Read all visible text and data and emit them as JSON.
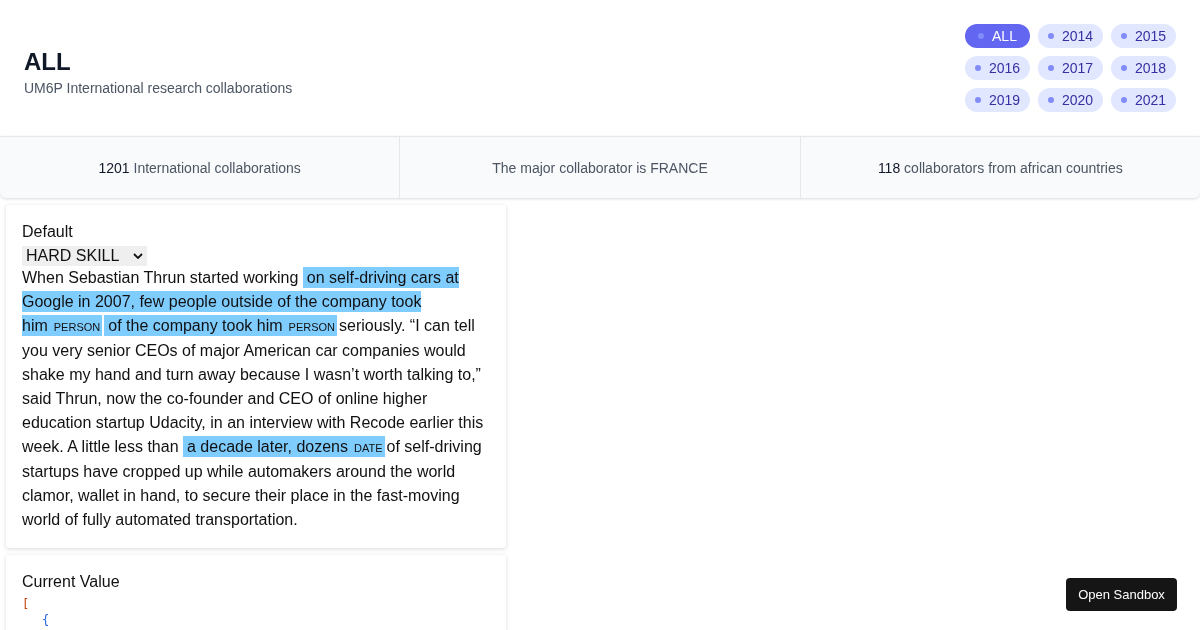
{
  "header": {
    "title": "ALL",
    "subtitle": "UM6P International research collaborations"
  },
  "year_filters": [
    {
      "label": "ALL",
      "selected": true
    },
    {
      "label": "2014",
      "selected": false
    },
    {
      "label": "2015",
      "selected": false
    },
    {
      "label": "2016",
      "selected": false
    },
    {
      "label": "2017",
      "selected": false
    },
    {
      "label": "2018",
      "selected": false
    },
    {
      "label": "2019",
      "selected": false
    },
    {
      "label": "2020",
      "selected": false
    },
    {
      "label": "2021",
      "selected": false
    }
  ],
  "stats": [
    "**1201** International collaborations",
    "The major collaborator is FRANCE",
    "**118** collaborators from african countries"
  ],
  "annotator": {
    "label": "Default",
    "select_value": "HARD SKILL",
    "lines": [
      [
        {
          "kind": "text",
          "text": "When Sebastian Thrun started working "
        },
        {
          "kind": "entity",
          "text": "on self-driving cars at"
        }
      ],
      [
        {
          "kind": "entity",
          "text": "Google in 2007, few people outside of the company took"
        }
      ],
      [
        {
          "kind": "entity",
          "text": "him",
          "label": "PERSON"
        },
        {
          "kind": "entity",
          "text": "of the company took him",
          "label": "PERSON"
        },
        {
          "kind": "text",
          "text": "seriously. “I can tell"
        }
      ],
      [
        {
          "kind": "text",
          "text": "you very senior CEOs of major American car companies would"
        }
      ],
      [
        {
          "kind": "text",
          "text": "shake my hand and turn away because I wasn’t worth talking to,”"
        }
      ],
      [
        {
          "kind": "text",
          "text": "said Thrun, now the co-founder and CEO of online higher"
        }
      ],
      [
        {
          "kind": "text",
          "text": "education startup Udacity, in an interview with Recode earlier this"
        }
      ],
      [
        {
          "kind": "text",
          "text": "week. A little less than "
        },
        {
          "kind": "entity",
          "text": "a decade later, dozens",
          "label": "DATE"
        },
        {
          "kind": "text",
          "text": "of self-driving"
        }
      ],
      [
        {
          "kind": "text",
          "text": "startups have cropped up while automakers around the world"
        }
      ],
      [
        {
          "kind": "text",
          "text": "clamor, wallet in hand, to secure their place in the fast-moving"
        }
      ],
      [
        {
          "kind": "text",
          "text": "world of fully automated transportation."
        }
      ]
    ]
  },
  "current_value": {
    "label": "Current Value",
    "code_lines": [
      "[",
      "{"
    ]
  },
  "sandbox_button": "Open Sandbox"
}
